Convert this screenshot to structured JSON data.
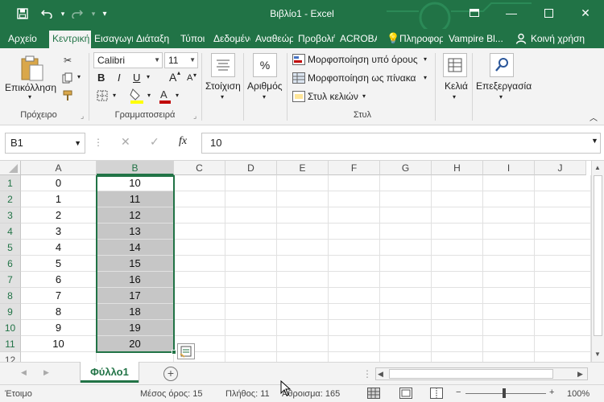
{
  "window": {
    "title": "Βιβλίο1 - Excel",
    "colors": {
      "brand": "#217346",
      "selection": "#c6c6c6"
    }
  },
  "quick_access": {
    "save_icon": "save-icon",
    "undo_icon": "undo-icon",
    "redo_icon": "redo-icon",
    "customize_icon": "customize-icon"
  },
  "tabs": [
    {
      "label": "Αρχείο"
    },
    {
      "label": "Κεντρική",
      "active": true
    },
    {
      "label": "Εισαγωγή"
    },
    {
      "label": "Διάταξη"
    },
    {
      "label": "Τύποι"
    },
    {
      "label": "Δεδομένα"
    },
    {
      "label": "Αναθεώρηση"
    },
    {
      "label": "Προβολή"
    },
    {
      "label": "ACROBAT"
    },
    {
      "label": "Πληροφορίες"
    },
    {
      "label": "Vampire Bl..."
    },
    {
      "label": "Κοινή χρήση"
    }
  ],
  "ribbon": {
    "clipboard": {
      "paste_label": "Επικόλληση",
      "group_label": "Πρόχειρο"
    },
    "font": {
      "name": "Calibri",
      "size": "11",
      "group_label": "Γραμματοσειρά",
      "bold": "B",
      "italic": "I",
      "underline": "U",
      "grow": "A",
      "shrink": "A"
    },
    "alignment": {
      "label": "Στοίχιση"
    },
    "number": {
      "label": "Αριθμός",
      "symbol": "%"
    },
    "styles": {
      "conditional": "Μορφοποίηση υπό όρους",
      "as_table": "Μορφοποίηση ως πίνακα",
      "cell_styles": "Στυλ κελιών",
      "group_label": "Στυλ"
    },
    "cells": {
      "label": "Κελιά"
    },
    "editing": {
      "label": "Επεξεργασία"
    }
  },
  "formula_bar": {
    "name_box": "B1",
    "fx": "fx",
    "value": "10"
  },
  "columns": [
    "A",
    "B",
    "C",
    "D",
    "E",
    "F",
    "G",
    "H",
    "I",
    "J"
  ],
  "rows": [
    {
      "n": "1",
      "a": "0",
      "b": "10"
    },
    {
      "n": "2",
      "a": "1",
      "b": "11"
    },
    {
      "n": "3",
      "a": "2",
      "b": "12"
    },
    {
      "n": "4",
      "a": "3",
      "b": "13"
    },
    {
      "n": "5",
      "a": "4",
      "b": "14"
    },
    {
      "n": "6",
      "a": "5",
      "b": "15"
    },
    {
      "n": "7",
      "a": "6",
      "b": "16"
    },
    {
      "n": "8",
      "a": "7",
      "b": "17"
    },
    {
      "n": "9",
      "a": "8",
      "b": "18"
    },
    {
      "n": "10",
      "a": "9",
      "b": "19"
    },
    {
      "n": "11",
      "a": "10",
      "b": "20"
    },
    {
      "n": "12",
      "a": "",
      "b": ""
    }
  ],
  "sheet": {
    "tab": "Φύλλο1",
    "add": "+"
  },
  "status": {
    "ready": "Έτοιμο",
    "average": "Μέσος όρος: 15",
    "count": "Πλήθος: 11",
    "sum": "Άθροισμα: 165",
    "zoom": "100%",
    "zoom_level": 1.0
  }
}
